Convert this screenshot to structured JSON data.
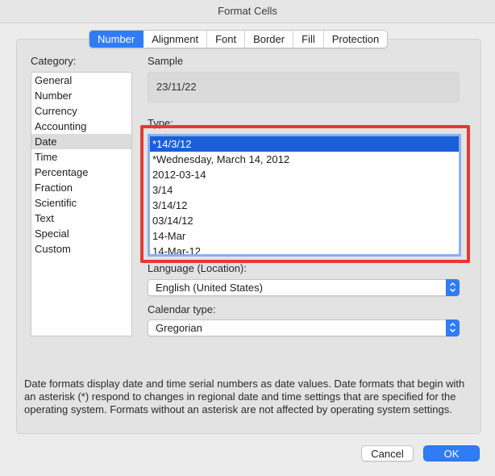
{
  "window": {
    "title": "Format Cells"
  },
  "tabs": [
    {
      "label": "Number",
      "active": true
    },
    {
      "label": "Alignment"
    },
    {
      "label": "Font"
    },
    {
      "label": "Border"
    },
    {
      "label": "Fill"
    },
    {
      "label": "Protection"
    }
  ],
  "category": {
    "label": "Category:",
    "items": [
      "General",
      "Number",
      "Currency",
      "Accounting",
      "Date",
      "Time",
      "Percentage",
      "Fraction",
      "Scientific",
      "Text",
      "Special",
      "Custom"
    ],
    "selected": "Date"
  },
  "sample": {
    "label": "Sample",
    "value": "23/11/22"
  },
  "type": {
    "label": "Type:",
    "items": [
      "*14/3/12",
      "*Wednesday, March 14, 2012",
      "2012-03-14",
      "3/14",
      "3/14/12",
      "03/14/12",
      "14-Mar",
      "14-Mar-12"
    ],
    "selected": "*14/3/12"
  },
  "language": {
    "label": "Language (Location):",
    "value": "English (United States)"
  },
  "calendar": {
    "label": "Calendar type:",
    "value": "Gregorian"
  },
  "description": "Date formats display date and time serial numbers as date values.  Date formats that begin with an asterisk (*) respond to changes in regional date and time settings that are specified for the operating system. Formats without an asterisk are not affected by operating system settings.",
  "buttons": {
    "cancel": "Cancel",
    "ok": "OK"
  },
  "colors": {
    "accent": "#2f7cf6",
    "highlight": "#e53934",
    "selection": "#1a5fd8"
  }
}
